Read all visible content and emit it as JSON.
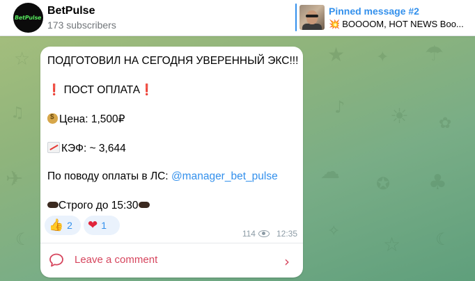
{
  "header": {
    "avatar_text": "BetPulse",
    "title": "BetPulse",
    "subscribers": "173 subscribers"
  },
  "pinned": {
    "title": "Pinned message #2",
    "emoji": "💥",
    "text": "BOOOOM, HOT NEWS Boo..."
  },
  "message": {
    "line1": "ПОДГОТОВИЛ НА СЕГОДНЯ УВЕРЕННЫЙ ЭКС!!!",
    "line2_mark": "❗",
    "line2": " ПОСТ ОПЛАТА",
    "line2_mark_end": "❗",
    "price": "Цена: 1,500₽",
    "coef": "КЭФ: ~ 3,644",
    "payment_prefix": "По поводу оплаты в ЛС: ",
    "payment_link": "@manager_bet_pulse",
    "deadline": "Строго до 15:30",
    "reactions": [
      {
        "emoji": "👍",
        "count": "2"
      },
      {
        "emoji": "❤",
        "count": "1"
      }
    ],
    "views": "114",
    "time": "12:35"
  },
  "comments": {
    "label": "Leave a comment"
  },
  "colors": {
    "accent": "#3390ec",
    "comment": "#d6455d",
    "brand_green": "#53e05a"
  }
}
